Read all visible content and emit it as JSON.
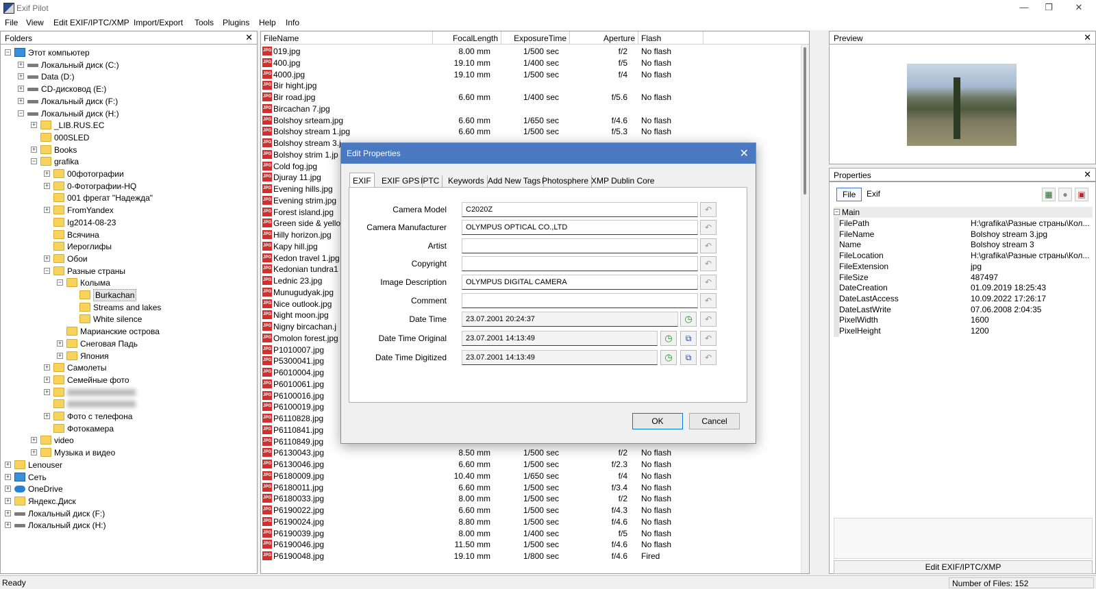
{
  "app": {
    "title": "Exif Pilot"
  },
  "window_controls": {
    "minimize": "—",
    "maximize": "❐",
    "close": "✕"
  },
  "menu": [
    "File",
    "View",
    "Edit EXIF/IPTC/XMP",
    "Import/Export",
    "Tools",
    "Plugins",
    "Help",
    "Info"
  ],
  "folders": {
    "title": "Folders",
    "close": "✕",
    "items": [
      {
        "label": "Этот компьютер",
        "toggle": "−",
        "icon": "pc"
      },
      {
        "label": "Локальный диск (C:)",
        "toggle": "+",
        "icon": "drive"
      },
      {
        "label": "Data (D:)",
        "toggle": "+",
        "icon": "drive"
      },
      {
        "label": "CD-дисковод (E:)",
        "toggle": "+",
        "icon": "drive"
      },
      {
        "label": "Локальный диск (F:)",
        "toggle": "+",
        "icon": "drive"
      },
      {
        "label": "Локальный диск (H:)",
        "toggle": "−",
        "icon": "drive"
      },
      {
        "label": "_LIB.RUS.EC",
        "toggle": "+",
        "icon": "folder"
      },
      {
        "label": "000SLED",
        "toggle": "",
        "icon": "folder"
      },
      {
        "label": "Books",
        "toggle": "+",
        "icon": "folder"
      },
      {
        "label": "grafika",
        "toggle": "−",
        "icon": "folder"
      },
      {
        "label": "00фотографии",
        "toggle": "+",
        "icon": "folder"
      },
      {
        "label": "0-Фотографии-HQ",
        "toggle": "+",
        "icon": "folder"
      },
      {
        "label": "001 фрегат \"Надежда\"",
        "toggle": "",
        "icon": "folder"
      },
      {
        "label": "FromYandex",
        "toggle": "+",
        "icon": "folder"
      },
      {
        "label": "Ig2014-08-23",
        "toggle": "",
        "icon": "folder"
      },
      {
        "label": "Всячина",
        "toggle": "",
        "icon": "folder"
      },
      {
        "label": "Иероглифы",
        "toggle": "",
        "icon": "folder"
      },
      {
        "label": "Обои",
        "toggle": "+",
        "icon": "folder"
      },
      {
        "label": "Разные страны",
        "toggle": "−",
        "icon": "folder"
      },
      {
        "label": "Колыма",
        "toggle": "−",
        "icon": "folder"
      },
      {
        "label": "Burkachan",
        "toggle": "",
        "icon": "folder"
      },
      {
        "label": "Streams and lakes",
        "toggle": "",
        "icon": "folder"
      },
      {
        "label": "White silence",
        "toggle": "",
        "icon": "folder"
      },
      {
        "label": "Марианские острова",
        "toggle": "",
        "icon": "folder"
      },
      {
        "label": "Снеговая Падь",
        "toggle": "+",
        "icon": "folder"
      },
      {
        "label": "Япония",
        "toggle": "+",
        "icon": "folder"
      },
      {
        "label": "Самолеты",
        "toggle": "+",
        "icon": "folder"
      },
      {
        "label": "Семейные фото",
        "toggle": "+",
        "icon": "folder"
      },
      {
        "label": "",
        "toggle": "+",
        "icon": "folder"
      },
      {
        "label": "",
        "toggle": "",
        "icon": "folder"
      },
      {
        "label": "Фото с телефона",
        "toggle": "+",
        "icon": "folder"
      },
      {
        "label": "Фотокамера",
        "toggle": "",
        "icon": "folder"
      },
      {
        "label": "video",
        "toggle": "+",
        "icon": "folder"
      },
      {
        "label": "Музыка и видео",
        "toggle": "+",
        "icon": "folder"
      },
      {
        "label": "Lenouser",
        "toggle": "+",
        "icon": "folder"
      },
      {
        "label": "Сеть",
        "toggle": "+",
        "icon": "network"
      },
      {
        "label": "OneDrive",
        "toggle": "+",
        "icon": "cloud"
      },
      {
        "label": "Яндекс.Диск",
        "toggle": "+",
        "icon": "yadisk"
      },
      {
        "label": "Локальный диск (F:)",
        "toggle": "+",
        "icon": "drive"
      },
      {
        "label": "Локальный диск (H:)",
        "toggle": "+",
        "icon": "drive"
      }
    ]
  },
  "filelist": {
    "columns": [
      "FileName",
      "FocalLength",
      "ExposureTime",
      "Aperture",
      "Flash"
    ],
    "icon_text": "JPG",
    "rows": [
      [
        "019.jpg",
        "8.00 mm",
        "1/500 sec",
        "f/2",
        "No flash"
      ],
      [
        "400.jpg",
        "19.10 mm",
        "1/400 sec",
        "f/5",
        "No flash"
      ],
      [
        "4000.jpg",
        "19.10 mm",
        "1/500 sec",
        "f/4",
        "No flash"
      ],
      [
        "Bir hight.jpg",
        "",
        "",
        "",
        ""
      ],
      [
        "Bir road.jpg",
        "6.60 mm",
        "1/400 sec",
        "f/5.6",
        "No flash"
      ],
      [
        "Bircachan 7.jpg",
        "",
        "",
        "",
        ""
      ],
      [
        "Bolshoy srteam.jpg",
        "6.60 mm",
        "1/650 sec",
        "f/4.6",
        "No flash"
      ],
      [
        "Bolshoy stream 1.jpg",
        "6.60 mm",
        "1/500 sec",
        "f/5.3",
        "No flash"
      ],
      [
        "Bolshoy stream 3.j",
        "",
        "",
        "",
        ""
      ],
      [
        "Bolshoy strim 1.jp",
        "",
        "",
        "",
        ""
      ],
      [
        "Cold fog.jpg",
        "",
        "",
        "",
        ""
      ],
      [
        "Djuray 11.jpg",
        "",
        "",
        "",
        ""
      ],
      [
        "Evening hills.jpg",
        "",
        "",
        "",
        ""
      ],
      [
        "Evening strim.jpg",
        "",
        "",
        "",
        ""
      ],
      [
        "Forest island.jpg",
        "",
        "",
        "",
        ""
      ],
      [
        "Green side & yello",
        "",
        "",
        "",
        ""
      ],
      [
        "Hilly horizon.jpg",
        "",
        "",
        "",
        ""
      ],
      [
        "Kapy hill.jpg",
        "",
        "",
        "",
        ""
      ],
      [
        "Kedon travel 1.jpg",
        "",
        "",
        "",
        ""
      ],
      [
        "Kedonian tundra1",
        "",
        "",
        "",
        ""
      ],
      [
        "Lednic 23.jpg",
        "",
        "",
        "",
        ""
      ],
      [
        "Munugudyak.jpg",
        "",
        "",
        "",
        ""
      ],
      [
        "Nice outlook.jpg",
        "",
        "",
        "",
        ""
      ],
      [
        "Night moon.jpg",
        "",
        "",
        "",
        ""
      ],
      [
        "Nigny bircachan.j",
        "",
        "",
        "",
        ""
      ],
      [
        "Omolon forest.jpg",
        "",
        "",
        "",
        ""
      ],
      [
        "P1010007.jpg",
        "",
        "",
        "",
        ""
      ],
      [
        "P5300041.jpg",
        "",
        "",
        "",
        ""
      ],
      [
        "P6010004.jpg",
        "",
        "",
        "",
        ""
      ],
      [
        "P6010061.jpg",
        "",
        "",
        "",
        ""
      ],
      [
        "P6100016.jpg",
        "",
        "",
        "",
        ""
      ],
      [
        "P6100019.jpg",
        "",
        "",
        "",
        ""
      ],
      [
        "P6110828.jpg",
        "",
        "",
        "",
        ""
      ],
      [
        "P6110841.jpg",
        "",
        "",
        "",
        ""
      ],
      [
        "P6110849.jpg",
        "",
        "",
        "",
        ""
      ],
      [
        "P6130043.jpg",
        "8.50 mm",
        "1/500 sec",
        "f/2",
        "No flash"
      ],
      [
        "P6130046.jpg",
        "6.60 mm",
        "1/500 sec",
        "f/2.3",
        "No flash"
      ],
      [
        "P6180009.jpg",
        "10.40 mm",
        "1/650 sec",
        "f/4",
        "No flash"
      ],
      [
        "P6180011.jpg",
        "6.60 mm",
        "1/500 sec",
        "f/3.4",
        "No flash"
      ],
      [
        "P6180033.jpg",
        "8.00 mm",
        "1/500 sec",
        "f/2",
        "No flash"
      ],
      [
        "P6190022.jpg",
        "6.60 mm",
        "1/500 sec",
        "f/4.3",
        "No flash"
      ],
      [
        "P6190024.jpg",
        "8.80 mm",
        "1/500 sec",
        "f/4.6",
        "No flash"
      ],
      [
        "P6190039.jpg",
        "8.00 mm",
        "1/400 sec",
        "f/5",
        "No flash"
      ],
      [
        "P6190046.jpg",
        "11.50 mm",
        "1/500 sec",
        "f/4.6",
        "No flash"
      ],
      [
        "P6190048.jpg",
        "19.10 mm",
        "1/800 sec",
        "f/4.6",
        "Fired"
      ]
    ]
  },
  "preview": {
    "title": "Preview",
    "close": "✕"
  },
  "properties": {
    "title": "Properties",
    "close": "✕",
    "tabs": [
      "File",
      "Exif"
    ],
    "category": "Main",
    "rows": [
      [
        "FilePath",
        "H:\\grafika\\Разные страны\\Кол..."
      ],
      [
        "FileName",
        "Bolshoy stream 3.jpg"
      ],
      [
        "Name",
        "Bolshoy stream 3"
      ],
      [
        "FileLocation",
        "H:\\grafika\\Разные страны\\Кол..."
      ],
      [
        "FileExtension",
        "jpg"
      ],
      [
        "FileSize",
        "487497"
      ],
      [
        "DateCreation",
        "01.09.2019 18:25:43"
      ],
      [
        "DateLastAccess",
        "10.09.2022 17:26:17"
      ],
      [
        "DateLastWrite",
        "07.06.2008 2:04:35"
      ],
      [
        "PixelWidth",
        "1600"
      ],
      [
        "PixelHeight",
        "1200"
      ]
    ],
    "edit_button": "Edit EXIF/IPTC/XMP"
  },
  "status": {
    "left": "Ready",
    "right": "Number of Files: 152"
  },
  "dialog": {
    "title": "Edit Properties",
    "close": "✕",
    "tabs": [
      "EXIF",
      "EXIF GPS",
      "IPTC",
      "Keywords",
      "Add New Tags",
      "Photosphere",
      "XMP Dublin Core"
    ],
    "fields": [
      {
        "label": "Camera Model",
        "value": "C2020Z"
      },
      {
        "label": "Camera Manufacturer",
        "value": "OLYMPUS OPTICAL CO.,LTD"
      },
      {
        "label": "Artist",
        "value": ""
      },
      {
        "label": "Copyright",
        "value": ""
      },
      {
        "label": "Image Description",
        "value": "OLYMPUS DIGITAL CAMERA"
      },
      {
        "label": "Comment",
        "value": ""
      },
      {
        "label": "Date Time",
        "value": "23.07.2001 20:24:37"
      },
      {
        "label": "Date Time Original",
        "value": "23.07.2001 14:13:49"
      },
      {
        "label": "Date Time Digitized",
        "value": "23.07.2001 14:13:49"
      }
    ],
    "ok": "OK",
    "cancel": "Cancel"
  }
}
